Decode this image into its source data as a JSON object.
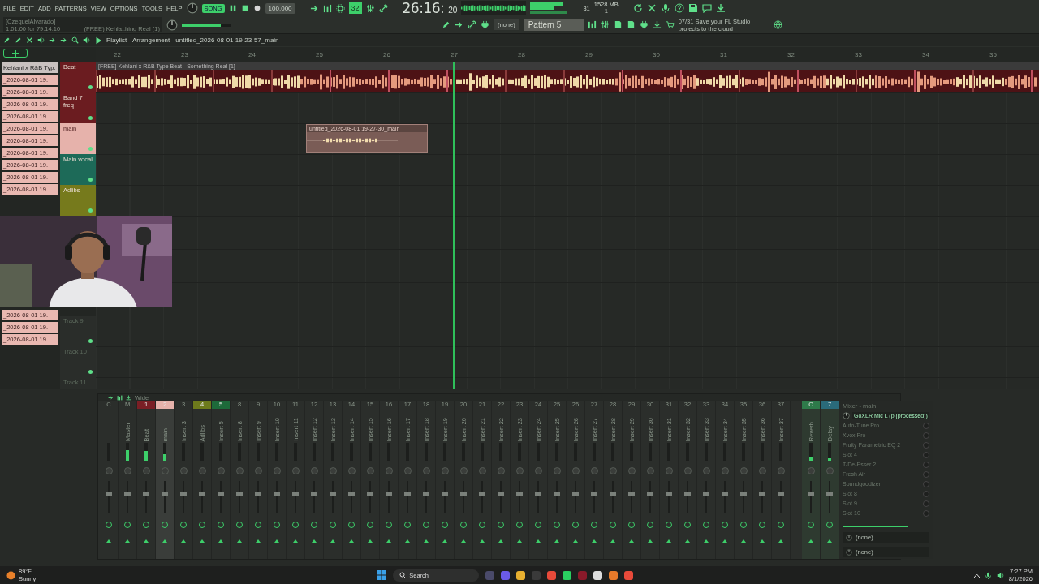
{
  "menu": [
    "FILE",
    "EDIT",
    "ADD",
    "PATTERNS",
    "VIEW",
    "OPTIONS",
    "TOOLS",
    "HELP"
  ],
  "transport": {
    "song_mode": true,
    "mode_label": "SONG",
    "tempo": "100.000",
    "step": "32",
    "time": "26:16:",
    "time_ticks": "20",
    "cpu": "31",
    "memory": "1528 MB",
    "voices": "1"
  },
  "hint": {
    "user": "[CzequelAlvarado]",
    "position": "1:01:00 for 79:14:10",
    "pattern_name": "(FREE) Kehla..hing Real (1)"
  },
  "master_volume": {
    "level": 0.8
  },
  "channel_select": "(none)",
  "pattern": "Pattern 5",
  "news": {
    "date": "07/31",
    "text": "Save your FL Studio projects to the cloud"
  },
  "playlist": {
    "title": "Playlist - Arrangement - untitled_2026-08-01 19-23-57_main -",
    "ruler": [
      "22",
      "23",
      "24",
      "25",
      "26",
      "27",
      "28",
      "29",
      "30",
      "31",
      "32",
      "33",
      "34",
      "35"
    ],
    "playhead": {
      "level": 0.379
    },
    "picker": [
      {
        "label": "Kehlani x R&B Typ.",
        "selected": true
      },
      {
        "label": "_2026-08-01 19.",
        "selected": false
      },
      {
        "label": "_2026-08-01 19.",
        "selected": false
      },
      {
        "label": "_2026-08-01 19.",
        "selected": false
      },
      {
        "label": "_2026-08-01 19.",
        "selected": false
      },
      {
        "label": "_2026-08-01 19.",
        "selected": false
      },
      {
        "label": "_2026-08-01 19.",
        "selected": false
      },
      {
        "label": "_2026-08-01 19.",
        "selected": false
      },
      {
        "label": "_2026-08-01 19.",
        "selected": false
      },
      {
        "label": "_2026-08-01 19.",
        "selected": false
      },
      {
        "label": "_2026-08-01 19.",
        "selected": false
      }
    ],
    "picker_lower": [
      {
        "label": "_2026-08-01 19.",
        "selected": false
      },
      {
        "label": "_2026-08-01 19.",
        "selected": false
      },
      {
        "label": "_2026-08-01 19.",
        "selected": false
      }
    ],
    "tracks": [
      {
        "kind": "track",
        "name": "Beat",
        "color": "#6b1c20",
        "clips": [
          {
            "kind": "full",
            "label": "[FREE] Kehlani x R&B Type Beat - Something Real [1]"
          }
        ]
      },
      {
        "kind": "track",
        "name": "Band 7 freq",
        "color": "#6b1c20"
      },
      {
        "kind": "track",
        "name": "main",
        "color": "#e6b2ab",
        "clips": [
          {
            "kind": "short",
            "label": "untitled_2026-08-01 19-27-30_main"
          }
        ]
      },
      {
        "kind": "track",
        "name": "Main vocal",
        "color": "#1d6a58"
      },
      {
        "kind": "track",
        "name": "Adlibs",
        "color": "#767a1c"
      },
      {
        "kind": "hidden"
      },
      {
        "kind": "hidden"
      },
      {
        "kind": "hidden"
      },
      {
        "kind": "track",
        "name": "Track 9"
      },
      {
        "kind": "track",
        "name": "Track 10"
      },
      {
        "kind": "track",
        "name": "Track 11"
      }
    ]
  },
  "mixer": {
    "mode": "Wide",
    "title": "Mixer - main",
    "strips": [
      {
        "num": "C",
        "selected": false,
        "level": 0
      },
      {
        "num": "M",
        "name": "Master",
        "selected": false,
        "level": 0.6
      },
      {
        "num": "1",
        "name": "Beat",
        "color": "#7a1f25",
        "selected": false,
        "level": 0.55
      },
      {
        "num": "2",
        "name": "main",
        "color": "#e6b2ab",
        "selected": true,
        "level": 0.35
      },
      {
        "num": "3",
        "name": "Insert 3",
        "selected": false,
        "level": 0
      },
      {
        "num": "4",
        "name": "Adlibs",
        "color": "#6d7a1c",
        "selected": false,
        "level": 0
      },
      {
        "num": "5",
        "name": "Insert 5",
        "color": "#1d6a3a",
        "selected": false,
        "level": 0
      },
      {
        "num": "8",
        "name": "Insert 8",
        "selected": false,
        "level": 0
      },
      {
        "num": "9",
        "name": "Insert 9",
        "selected": false,
        "level": 0
      },
      {
        "num": "10",
        "name": "Insert 10",
        "selected": false,
        "level": 0
      },
      {
        "num": "11",
        "name": "Insert 11",
        "selected": false,
        "level": 0
      },
      {
        "num": "12",
        "name": "Insert 12",
        "selected": false,
        "level": 0
      },
      {
        "num": "13",
        "name": "Insert 13",
        "selected": false,
        "level": 0
      },
      {
        "num": "14",
        "name": "Insert 14",
        "selected": false,
        "level": 0
      },
      {
        "num": "15",
        "name": "Insert 15",
        "selected": false,
        "level": 0
      },
      {
        "num": "16",
        "name": "Insert 16",
        "selected": false,
        "level": 0
      },
      {
        "num": "17",
        "name": "Insert 17",
        "selected": false,
        "level": 0
      },
      {
        "num": "18",
        "name": "Insert 18",
        "selected": false,
        "level": 0
      },
      {
        "num": "19",
        "name": "Insert 19",
        "selected": false,
        "level": 0
      },
      {
        "num": "20",
        "name": "Insert 20",
        "selected": false,
        "level": 0
      },
      {
        "num": "21",
        "name": "Insert 21",
        "selected": false,
        "level": 0
      },
      {
        "num": "22",
        "name": "Insert 22",
        "selected": false,
        "level": 0
      },
      {
        "num": "23",
        "name": "Insert 23",
        "selected": false,
        "level": 0
      },
      {
        "num": "24",
        "name": "Insert 24",
        "selected": false,
        "level": 0
      },
      {
        "num": "25",
        "name": "Insert 25",
        "selected": false,
        "level": 0
      },
      {
        "num": "26",
        "name": "Insert 26",
        "selected": false,
        "level": 0
      },
      {
        "num": "27",
        "name": "Insert 27",
        "selected": false,
        "level": 0
      },
      {
        "num": "28",
        "name": "Insert 28",
        "selected": false,
        "level": 0
      },
      {
        "num": "29",
        "name": "Insert 29",
        "selected": false,
        "level": 0
      },
      {
        "num": "30",
        "name": "Insert 30",
        "selected": false,
        "level": 0
      },
      {
        "num": "31",
        "name": "Insert 31",
        "selected": false,
        "level": 0
      },
      {
        "num": "32",
        "name": "Insert 32",
        "selected": false,
        "level": 0
      },
      {
        "num": "33",
        "name": "Insert 33",
        "selected": false,
        "level": 0
      },
      {
        "num": "34",
        "name": "Insert 34",
        "selected": false,
        "level": 0
      },
      {
        "num": "35",
        "name": "Insert 35",
        "selected": false,
        "level": 0
      },
      {
        "num": "36",
        "name": "Insert 36",
        "selected": false,
        "level": 0
      },
      {
        "num": "37",
        "name": "Insert 37",
        "selected": false,
        "level": 0
      }
    ],
    "sends": [
      {
        "num": "C",
        "name": "Reverb",
        "color": "#2e7a4a",
        "selected": false,
        "level": 0.2
      },
      {
        "num": "7",
        "name": "Delay",
        "color": "#2a6a7a",
        "selected": false,
        "level": 0.15
      }
    ],
    "panel": {
      "title": "GoXLR Mic L (p.(processed))",
      "slots": [
        "Auto-Tune Pro",
        "Xvox Pro",
        "Fruity Parametric EQ 2",
        "Slot 4",
        "T-De-Esser 2",
        "Fresh Air",
        "Soundgoodizer",
        "Slot 8",
        "Slot 9",
        "Slot 10"
      ],
      "outputs": [
        "(none)",
        "(none)"
      ]
    }
  },
  "taskbar": {
    "temperature": "89°F",
    "condition": "Sunny",
    "search": "Search",
    "time": "7:27 PM",
    "date": "8/1/2026"
  }
}
